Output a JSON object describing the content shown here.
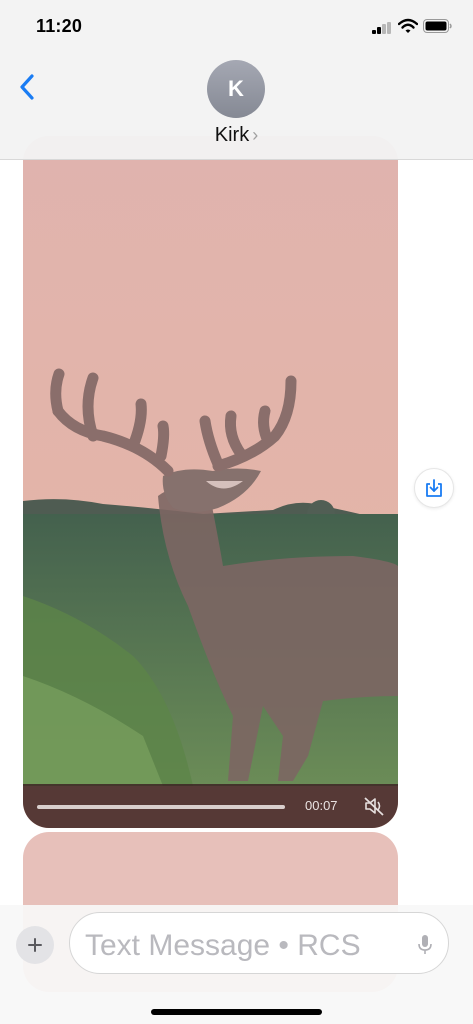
{
  "status_bar": {
    "time": "11:20"
  },
  "header": {
    "contact_initial": "K",
    "contact_name": "Kirk",
    "chevron": "›"
  },
  "messages": {
    "video": {
      "duration": "00:07",
      "progress": 0.0
    },
    "save_icon": "save-to-photos-icon"
  },
  "compose": {
    "placeholder": "Text Message • RCS"
  },
  "colors": {
    "accent": "#1a7cf3",
    "video_bg": "#dfb4ae"
  }
}
